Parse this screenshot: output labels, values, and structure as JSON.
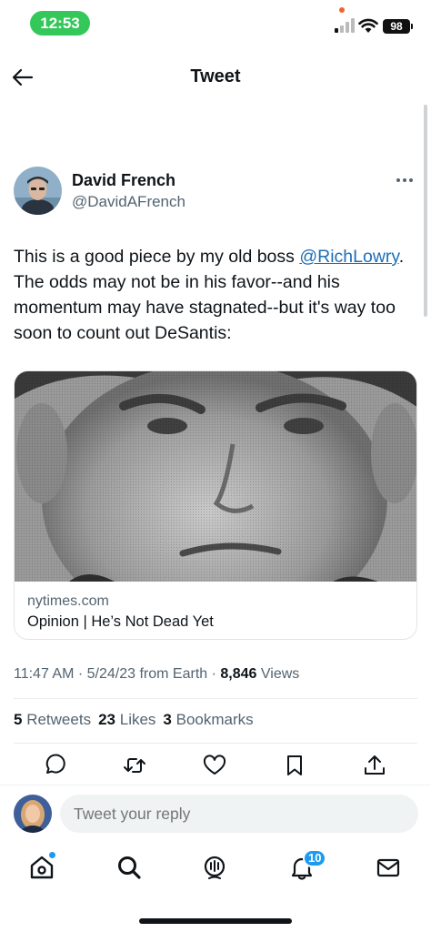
{
  "status_bar": {
    "time": "12:53",
    "battery": "98"
  },
  "header": {
    "title": "Tweet"
  },
  "tweet": {
    "author_name": "David French",
    "author_handle": "@DavidAFrench",
    "text_before": "This is a good piece by my old boss ",
    "mention": "@RichLowry",
    "text_after": ". The odds may not be in his favor--and his momentum may have stagnated--but it's way too soon to count out DeSantis:",
    "card": {
      "domain": "nytimes.com",
      "title": "Opinion | He’s Not Dead Yet"
    },
    "time": "11:47 AM",
    "date": "5/24/23",
    "source": "from Earth",
    "views_count": "8,846",
    "views_label": "Views",
    "retweets_count": "5",
    "retweets_label": "Retweets",
    "likes_count": "23",
    "likes_label": "Likes",
    "bookmarks_count": "3",
    "bookmarks_label": "Bookmarks"
  },
  "reply": {
    "placeholder": "Tweet your reply"
  },
  "tabbar": {
    "items": [
      "home-icon",
      "search-icon",
      "spaces-icon",
      "notifications-icon",
      "messages-icon"
    ],
    "notifications_badge": "10"
  },
  "colors": {
    "accent": "#1d9bf0",
    "mention": "#1d6fb8",
    "time_pill": "#34c759",
    "text_secondary": "#536471"
  }
}
